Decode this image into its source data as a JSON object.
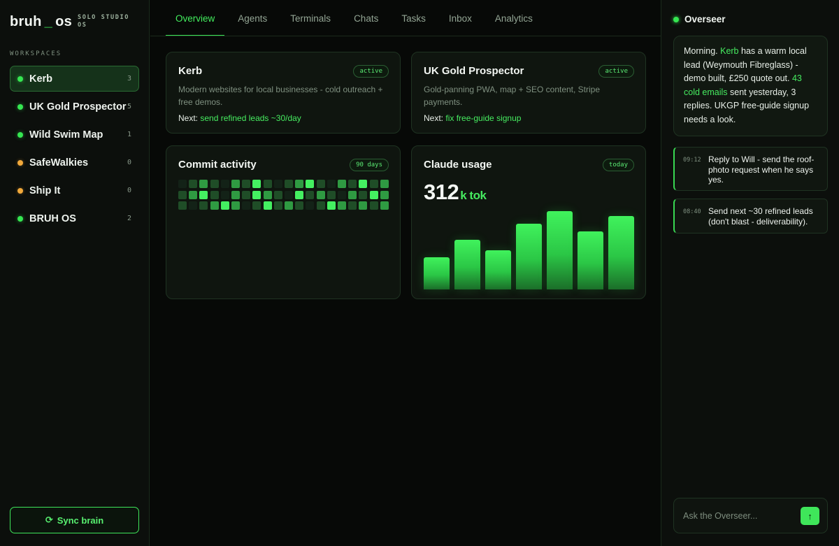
{
  "brand": {
    "name_left": "bruh",
    "cursor": "_",
    "name_right": "os",
    "sub_line1": "SOLO STUDIO",
    "sub_line2": "OS"
  },
  "sidebar": {
    "section_label": "WORKSPACES",
    "items": [
      {
        "name": "Kerb",
        "count": "3",
        "status": "green",
        "active": true
      },
      {
        "name": "UK Gold Prospector",
        "count": "5",
        "status": "green"
      },
      {
        "name": "Wild Swim Map",
        "count": "1",
        "status": "green"
      },
      {
        "name": "SafeWalkies",
        "count": "0",
        "status": "orange"
      },
      {
        "name": "Ship It",
        "count": "0",
        "status": "orange"
      },
      {
        "name": "BRUH OS",
        "count": "2",
        "status": "green"
      }
    ],
    "sync_label": "Sync brain",
    "sync_icon": "refresh-icon"
  },
  "tabs": [
    "Overview",
    "Agents",
    "Terminals",
    "Chats",
    "Tasks",
    "Inbox",
    "Analytics"
  ],
  "active_tab": "Overview",
  "projects": [
    {
      "title": "Kerb",
      "badge": "active",
      "desc": "Modern websites for local businesses - cold outreach + free demos.",
      "next_label": "Next:",
      "next_value": "send refined leads ~30/day"
    },
    {
      "title": "UK Gold Prospector",
      "badge": "active",
      "desc": "Gold-panning PWA, map + SEO content, Stripe payments.",
      "next_label": "Next:",
      "next_value": "fix free-guide signup"
    }
  ],
  "commit_activity": {
    "title": "Commit activity",
    "badge": "90 days",
    "rows": 3,
    "cols": 20,
    "levels": [
      [
        0,
        1,
        2,
        1,
        0,
        2,
        1,
        3,
        1,
        0,
        1,
        2,
        3,
        1,
        0,
        2,
        1,
        3,
        1,
        2
      ],
      [
        1,
        2,
        3,
        1,
        0,
        2,
        1,
        3,
        2,
        1,
        0,
        3,
        1,
        2,
        1,
        0,
        2,
        1,
        3,
        2
      ],
      [
        1,
        0,
        1,
        2,
        3,
        2,
        0,
        1,
        3,
        1,
        2,
        1,
        0,
        1,
        3,
        2,
        1,
        2,
        1,
        2
      ]
    ],
    "palette": [
      "#132217",
      "#1f4d27",
      "#2f9a42",
      "#44f061"
    ]
  },
  "claude_usage": {
    "title": "Claude usage",
    "badge": "today",
    "value": "312",
    "unit": "k tok"
  },
  "chart_data": {
    "type": "bar",
    "title": "Claude usage",
    "categories": [],
    "values": [
      40,
      62,
      49,
      82,
      97,
      72,
      91
    ],
    "ylim": [
      0,
      100
    ]
  },
  "overseer": {
    "title": "Overseer",
    "message_parts": [
      {
        "t": "Morning. ",
        "hl": false
      },
      {
        "t": "Kerb",
        "hl": true
      },
      {
        "t": " has a warm local lead (Weymouth Fibreglass) - demo built, £250 quote out. ",
        "hl": false
      },
      {
        "t": "43 cold emails",
        "hl": true
      },
      {
        "t": " sent yesterday, 3 replies. UKGP free-guide signup needs a look.",
        "hl": false
      }
    ],
    "log": [
      {
        "time": "09:12",
        "text": "Reply to Will - send the roof-photo request when he says yes."
      },
      {
        "time": "08:40",
        "text": "Send next ~30 refined leads (don't blast - deliverability)."
      }
    ],
    "input_placeholder": "Ask the Overseer...",
    "send_icon": "arrow-up-icon"
  },
  "colors": {
    "accent": "#3fe65a",
    "status_green": "#35e651",
    "status_orange": "#f2a93b",
    "background": "#070907"
  }
}
